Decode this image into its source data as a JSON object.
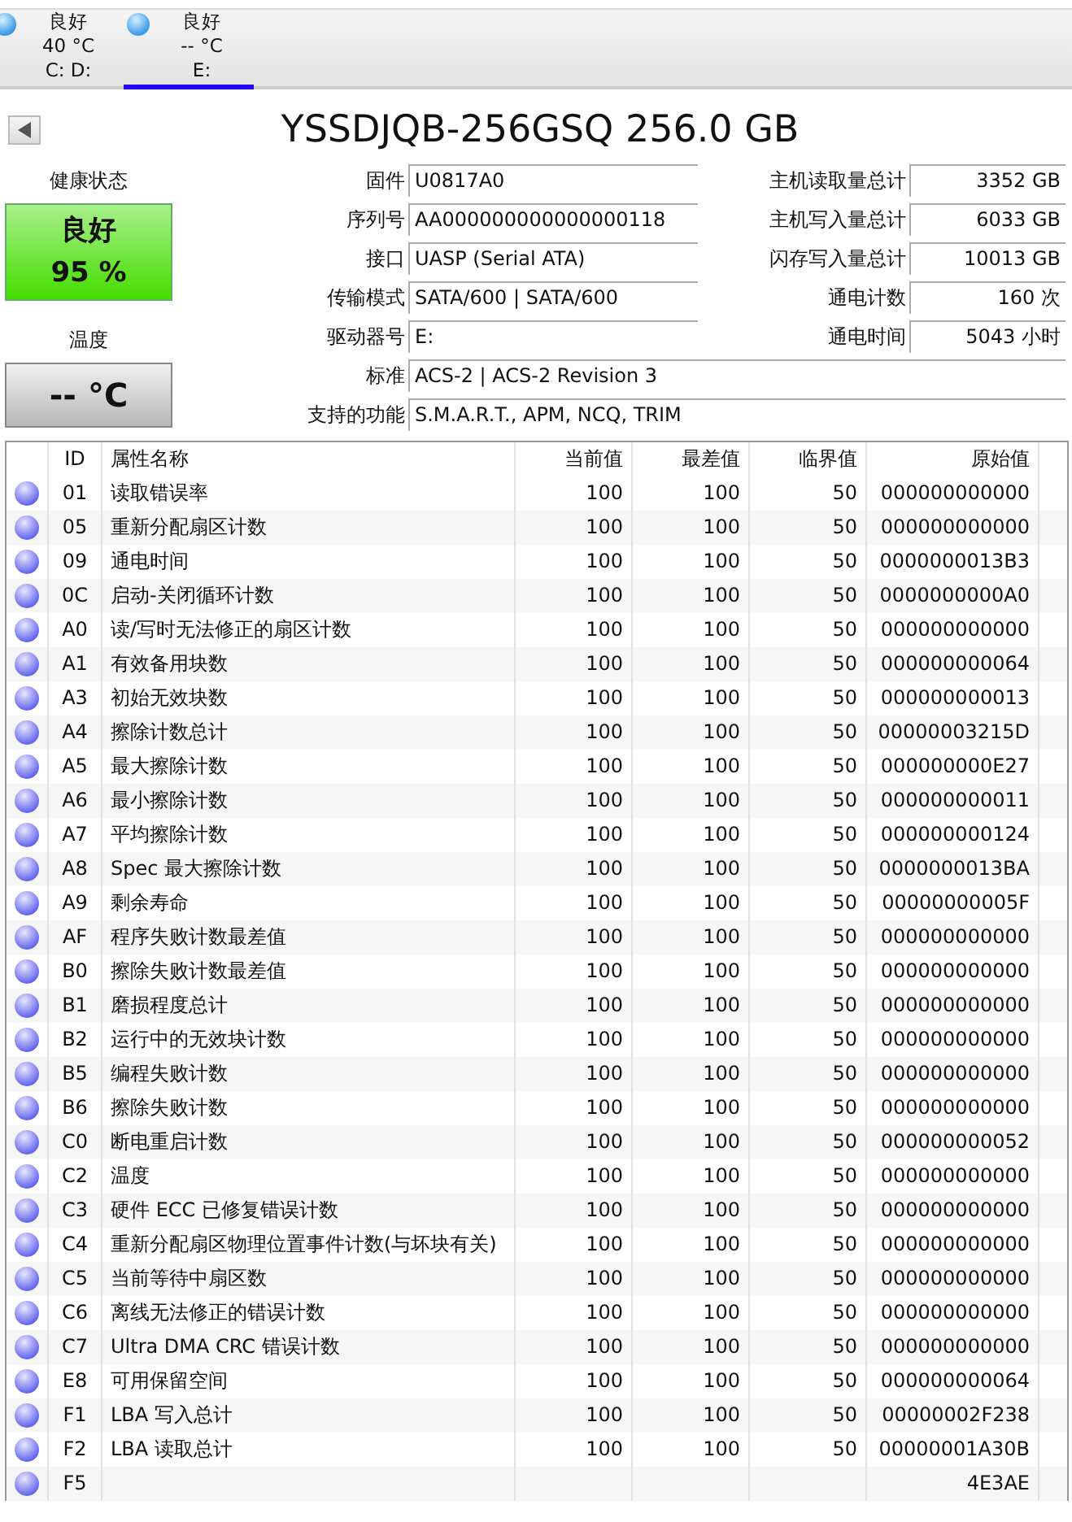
{
  "drive_tabs": [
    {
      "status": "良好",
      "temperature": "40 °C",
      "drives": "C: D:",
      "selected": false
    },
    {
      "status": "良好",
      "temperature": "-- °C",
      "drives": "E:",
      "selected": true
    }
  ],
  "title": "YSSDJQB-256GSQ 256.0 GB",
  "health": {
    "label": "健康状态",
    "status": "良好",
    "percent": "95 %",
    "kind": "good"
  },
  "temperature": {
    "label": "温度",
    "value": "-- °C",
    "kind": "unknown"
  },
  "info_left": [
    {
      "label": "固件",
      "value": "U0817A0"
    },
    {
      "label": "序列号",
      "value": "AA000000000000000118"
    },
    {
      "label": "接口",
      "value": "UASP (Serial ATA)"
    },
    {
      "label": "传输模式",
      "value": "SATA/600 | SATA/600"
    },
    {
      "label": "驱动器号",
      "value": "E:"
    }
  ],
  "info_right": [
    {
      "label": "主机读取量总计",
      "value": "3352 GB"
    },
    {
      "label": "主机写入量总计",
      "value": "6033 GB"
    },
    {
      "label": "闪存写入量总计",
      "value": "10013 GB"
    },
    {
      "label": "通电计数",
      "value": "160 次"
    },
    {
      "label": "通电时间",
      "value": "5043 小时"
    }
  ],
  "info_wide": [
    {
      "label": "标准",
      "value": "ACS-2 | ACS-2 Revision 3"
    },
    {
      "label": "支持的功能",
      "value": "S.M.A.R.T., APM, NCQ, TRIM"
    }
  ],
  "table": {
    "columns": [
      "ID",
      "属性名称",
      "当前值",
      "最差值",
      "临界值",
      "原始值"
    ],
    "rows": [
      {
        "id": "01",
        "name": "读取错误率",
        "current": "100",
        "worst": "100",
        "threshold": "50",
        "raw": "000000000000"
      },
      {
        "id": "05",
        "name": "重新分配扇区计数",
        "current": "100",
        "worst": "100",
        "threshold": "50",
        "raw": "000000000000"
      },
      {
        "id": "09",
        "name": "通电时间",
        "current": "100",
        "worst": "100",
        "threshold": "50",
        "raw": "0000000013B3"
      },
      {
        "id": "0C",
        "name": "启动-关闭循环计数",
        "current": "100",
        "worst": "100",
        "threshold": "50",
        "raw": "0000000000A0"
      },
      {
        "id": "A0",
        "name": "读/写时无法修正的扇区计数",
        "current": "100",
        "worst": "100",
        "threshold": "50",
        "raw": "000000000000"
      },
      {
        "id": "A1",
        "name": "有效备用块数",
        "current": "100",
        "worst": "100",
        "threshold": "50",
        "raw": "000000000064"
      },
      {
        "id": "A3",
        "name": "初始无效块数",
        "current": "100",
        "worst": "100",
        "threshold": "50",
        "raw": "000000000013"
      },
      {
        "id": "A4",
        "name": "擦除计数总计",
        "current": "100",
        "worst": "100",
        "threshold": "50",
        "raw": "00000003215D"
      },
      {
        "id": "A5",
        "name": "最大擦除计数",
        "current": "100",
        "worst": "100",
        "threshold": "50",
        "raw": "000000000E27"
      },
      {
        "id": "A6",
        "name": "最小擦除计数",
        "current": "100",
        "worst": "100",
        "threshold": "50",
        "raw": "000000000011"
      },
      {
        "id": "A7",
        "name": "平均擦除计数",
        "current": "100",
        "worst": "100",
        "threshold": "50",
        "raw": "000000000124"
      },
      {
        "id": "A8",
        "name": "Spec 最大擦除计数",
        "current": "100",
        "worst": "100",
        "threshold": "50",
        "raw": "0000000013BA"
      },
      {
        "id": "A9",
        "name": "剩余寿命",
        "current": "100",
        "worst": "100",
        "threshold": "50",
        "raw": "00000000005F"
      },
      {
        "id": "AF",
        "name": "程序失败计数最差值",
        "current": "100",
        "worst": "100",
        "threshold": "50",
        "raw": "000000000000"
      },
      {
        "id": "B0",
        "name": "擦除失败计数最差值",
        "current": "100",
        "worst": "100",
        "threshold": "50",
        "raw": "000000000000"
      },
      {
        "id": "B1",
        "name": "磨损程度总计",
        "current": "100",
        "worst": "100",
        "threshold": "50",
        "raw": "000000000000"
      },
      {
        "id": "B2",
        "name": "运行中的无效块计数",
        "current": "100",
        "worst": "100",
        "threshold": "50",
        "raw": "000000000000"
      },
      {
        "id": "B5",
        "name": "编程失败计数",
        "current": "100",
        "worst": "100",
        "threshold": "50",
        "raw": "000000000000"
      },
      {
        "id": "B6",
        "name": "擦除失败计数",
        "current": "100",
        "worst": "100",
        "threshold": "50",
        "raw": "000000000000"
      },
      {
        "id": "C0",
        "name": "断电重启计数",
        "current": "100",
        "worst": "100",
        "threshold": "50",
        "raw": "000000000052"
      },
      {
        "id": "C2",
        "name": "温度",
        "current": "100",
        "worst": "100",
        "threshold": "50",
        "raw": "000000000000"
      },
      {
        "id": "C3",
        "name": "硬件 ECC 已修复错误计数",
        "current": "100",
        "worst": "100",
        "threshold": "50",
        "raw": "000000000000"
      },
      {
        "id": "C4",
        "name": "重新分配扇区物理位置事件计数(与坏块有关)",
        "current": "100",
        "worst": "100",
        "threshold": "50",
        "raw": "000000000000"
      },
      {
        "id": "C5",
        "name": "当前等待中扇区数",
        "current": "100",
        "worst": "100",
        "threshold": "50",
        "raw": "000000000000"
      },
      {
        "id": "C6",
        "name": "离线无法修正的错误计数",
        "current": "100",
        "worst": "100",
        "threshold": "50",
        "raw": "000000000000"
      },
      {
        "id": "C7",
        "name": "Ultra DMA CRC 错误计数",
        "current": "100",
        "worst": "100",
        "threshold": "50",
        "raw": "000000000000"
      },
      {
        "id": "E8",
        "name": "可用保留空间",
        "current": "100",
        "worst": "100",
        "threshold": "50",
        "raw": "000000000064"
      },
      {
        "id": "F1",
        "name": "LBA 写入总计",
        "current": "100",
        "worst": "100",
        "threshold": "50",
        "raw": "00000002F238"
      },
      {
        "id": "F2",
        "name": "LBA 读取总计",
        "current": "100",
        "worst": "100",
        "threshold": "50",
        "raw": "00000001A30B"
      },
      {
        "id": "F5",
        "raw": "4E3AE"
      }
    ]
  }
}
